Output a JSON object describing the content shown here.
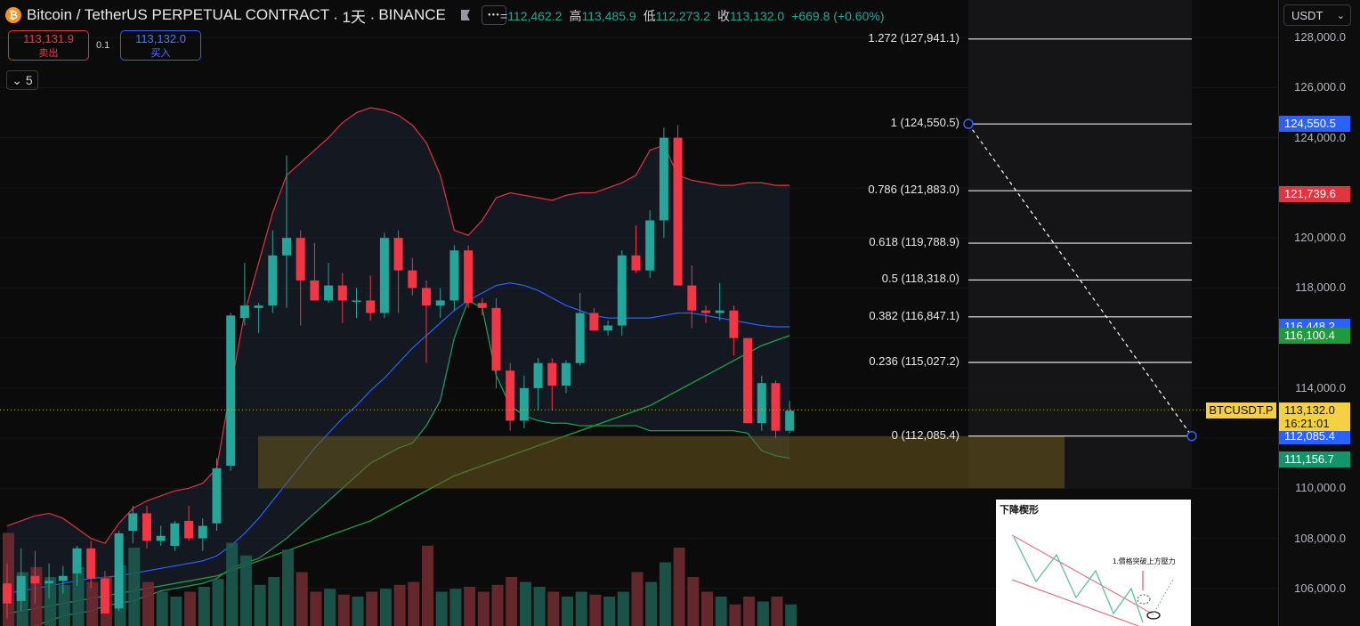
{
  "header": {
    "symbol_title": "Bitcoin / TetherUS PERPETUAL CONTRACT",
    "interval": "· 1天 ·",
    "exchange": "BINANCE",
    "logo_glyph": "₿",
    "more_glyph": "●●●"
  },
  "ohlc": {
    "open_label": "=",
    "open": "112,462.2",
    "high_label": "高",
    "high": "113,485.9",
    "low_label": "低",
    "low": "112,273.2",
    "close_label": "收",
    "close": "113,132.0",
    "change": "+669.8 (+0.60%)"
  },
  "trade": {
    "sell_price": "113,131.9",
    "sell_label": "卖出",
    "spread": "0.1",
    "buy_price": "113,132.0",
    "buy_label": "买入"
  },
  "indicator_collapse": {
    "count": "5"
  },
  "axis": {
    "currency": "USDT",
    "ticks": [
      "128,000.0",
      "126,000.0",
      "124,000.0",
      "120,000.0",
      "118,000.0",
      "114,000.0",
      "110,000.0",
      "108,000.0",
      "106,000.0"
    ],
    "labels": [
      {
        "text": "124,550.5",
        "color": "#2962ff"
      },
      {
        "text": "121,739.6",
        "color": "#e0343f"
      },
      {
        "text": "116,448.2",
        "color": "#2962ff"
      },
      {
        "text": "116,100.4",
        "color": "#1f9a3c"
      },
      {
        "text": "112,085.4",
        "color": "#2962ff"
      },
      {
        "text": "111,156.7",
        "color": "#13956b"
      }
    ],
    "symbol_tag": "BTCUSDT.P",
    "current_price": "113,132.0",
    "countdown": "16:21:01"
  },
  "fib_levels": [
    {
      "label": "1.272 (127,941.1)",
      "price": 127941.1
    },
    {
      "label": "1 (124,550.5)",
      "price": 124550.5
    },
    {
      "label": "0.786 (121,883.0)",
      "price": 121883.0
    },
    {
      "label": "0.618 (119,788.9)",
      "price": 119788.9
    },
    {
      "label": "0.5 (118,318.0)",
      "price": 118318.0
    },
    {
      "label": "0.382 (116,847.1)",
      "price": 116847.1
    },
    {
      "label": "0.236 (115,027.2)",
      "price": 115027.2
    },
    {
      "label": "0 (112,085.4)",
      "price": 112085.4
    }
  ],
  "inset": {
    "title": "下降楔形",
    "note": "1.價格突破上方壓力"
  },
  "colors": {
    "up": "#26a69a",
    "down": "#f23645",
    "bb_upper": "#e0343f",
    "bb_lower": "#20a060",
    "ma_blue": "#2962ff",
    "ma_green": "#1f9a3c",
    "zone": "#f5d14233"
  },
  "chart_data": {
    "type": "candlestick",
    "ylim": [
      104500,
      129500
    ],
    "candles": [
      {
        "o": 106200,
        "h": 107000,
        "l": 104800,
        "c": 105400
      },
      {
        "o": 105500,
        "h": 107600,
        "l": 105100,
        "c": 106500
      },
      {
        "o": 106500,
        "h": 107500,
        "l": 105400,
        "c": 106200
      },
      {
        "o": 106200,
        "h": 107000,
        "l": 105600,
        "c": 106300
      },
      {
        "o": 106300,
        "h": 106900,
        "l": 105800,
        "c": 106500
      },
      {
        "o": 106600,
        "h": 107700,
        "l": 106100,
        "c": 107600
      },
      {
        "o": 107600,
        "h": 107900,
        "l": 106000,
        "c": 106400
      },
      {
        "o": 106400,
        "h": 106700,
        "l": 105000,
        "c": 105000
      },
      {
        "o": 105200,
        "h": 108300,
        "l": 105100,
        "c": 108200
      },
      {
        "o": 108300,
        "h": 109300,
        "l": 107800,
        "c": 109000
      },
      {
        "o": 109000,
        "h": 109300,
        "l": 107600,
        "c": 107900
      },
      {
        "o": 107900,
        "h": 108500,
        "l": 107700,
        "c": 108100
      },
      {
        "o": 107700,
        "h": 108700,
        "l": 107500,
        "c": 108600
      },
      {
        "o": 108700,
        "h": 109300,
        "l": 107900,
        "c": 108000
      },
      {
        "o": 108000,
        "h": 108800,
        "l": 107500,
        "c": 108500
      },
      {
        "o": 108600,
        "h": 111200,
        "l": 108300,
        "c": 110800
      },
      {
        "o": 110900,
        "h": 117000,
        "l": 110700,
        "c": 116900
      },
      {
        "o": 116800,
        "h": 119000,
        "l": 116500,
        "c": 117300
      },
      {
        "o": 117200,
        "h": 117400,
        "l": 116200,
        "c": 117300
      },
      {
        "o": 117300,
        "h": 120300,
        "l": 117000,
        "c": 119300
      },
      {
        "o": 119300,
        "h": 123300,
        "l": 117200,
        "c": 120000
      },
      {
        "o": 120000,
        "h": 120300,
        "l": 116500,
        "c": 118300
      },
      {
        "o": 118300,
        "h": 119800,
        "l": 117600,
        "c": 117500
      },
      {
        "o": 117500,
        "h": 119000,
        "l": 117400,
        "c": 118100
      },
      {
        "o": 118100,
        "h": 118600,
        "l": 116600,
        "c": 117500
      },
      {
        "o": 117500,
        "h": 118000,
        "l": 116800,
        "c": 117500
      },
      {
        "o": 117500,
        "h": 118500,
        "l": 116700,
        "c": 117000
      },
      {
        "o": 117000,
        "h": 120200,
        "l": 116800,
        "c": 120000
      },
      {
        "o": 120000,
        "h": 120300,
        "l": 117000,
        "c": 118700
      },
      {
        "o": 118700,
        "h": 119200,
        "l": 117700,
        "c": 118000
      },
      {
        "o": 118000,
        "h": 118300,
        "l": 115000,
        "c": 117300
      },
      {
        "o": 117300,
        "h": 118000,
        "l": 116800,
        "c": 117500
      },
      {
        "o": 117500,
        "h": 119700,
        "l": 117100,
        "c": 119500
      },
      {
        "o": 119500,
        "h": 119700,
        "l": 117200,
        "c": 117400
      },
      {
        "o": 117400,
        "h": 117600,
        "l": 116900,
        "c": 117200
      },
      {
        "o": 117200,
        "h": 117600,
        "l": 114000,
        "c": 114700
      },
      {
        "o": 114700,
        "h": 115000,
        "l": 112300,
        "c": 112700
      },
      {
        "o": 112700,
        "h": 114500,
        "l": 112400,
        "c": 114000
      },
      {
        "o": 114000,
        "h": 115200,
        "l": 113100,
        "c": 115000
      },
      {
        "o": 115000,
        "h": 115200,
        "l": 113100,
        "c": 114100
      },
      {
        "o": 114100,
        "h": 115100,
        "l": 113800,
        "c": 115000
      },
      {
        "o": 115000,
        "h": 117800,
        "l": 114900,
        "c": 117000
      },
      {
        "o": 117000,
        "h": 117200,
        "l": 116500,
        "c": 116300
      },
      {
        "o": 116300,
        "h": 116700,
        "l": 116100,
        "c": 116500
      },
      {
        "o": 116500,
        "h": 119500,
        "l": 116100,
        "c": 119300
      },
      {
        "o": 119300,
        "h": 120500,
        "l": 118600,
        "c": 118700
      },
      {
        "o": 118700,
        "h": 121100,
        "l": 118400,
        "c": 120700
      },
      {
        "o": 120700,
        "h": 124400,
        "l": 120000,
        "c": 124000
      },
      {
        "o": 124000,
        "h": 124500,
        "l": 118100,
        "c": 118100
      },
      {
        "o": 118100,
        "h": 118900,
        "l": 116400,
        "c": 117100
      },
      {
        "o": 117100,
        "h": 117300,
        "l": 116600,
        "c": 117000
      },
      {
        "o": 117000,
        "h": 118200,
        "l": 116700,
        "c": 117100
      },
      {
        "o": 117100,
        "h": 117300,
        "l": 115300,
        "c": 116000
      },
      {
        "o": 116000,
        "h": 116000,
        "l": 112600,
        "c": 112600
      },
      {
        "o": 112600,
        "h": 114500,
        "l": 112300,
        "c": 114200
      },
      {
        "o": 114200,
        "h": 114300,
        "l": 112000,
        "c": 112300
      },
      {
        "o": 112300,
        "h": 113500,
        "l": 112200,
        "c": 113100
      }
    ],
    "volumes": [
      0.95,
      0.55,
      0.6,
      0.5,
      0.42,
      0.6,
      0.45,
      0.5,
      0.62,
      0.8,
      0.45,
      0.35,
      0.3,
      0.35,
      0.4,
      0.48,
      0.85,
      0.72,
      0.42,
      0.5,
      0.78,
      0.55,
      0.35,
      0.38,
      0.32,
      0.3,
      0.35,
      0.38,
      0.42,
      0.45,
      0.82,
      0.35,
      0.38,
      0.4,
      0.35,
      0.42,
      0.5,
      0.45,
      0.4,
      0.35,
      0.3,
      0.35,
      0.32,
      0.3,
      0.35,
      0.55,
      0.45,
      0.65,
      0.8,
      0.5,
      0.35,
      0.3,
      0.22,
      0.3,
      0.25,
      0.3,
      0.22
    ]
  }
}
